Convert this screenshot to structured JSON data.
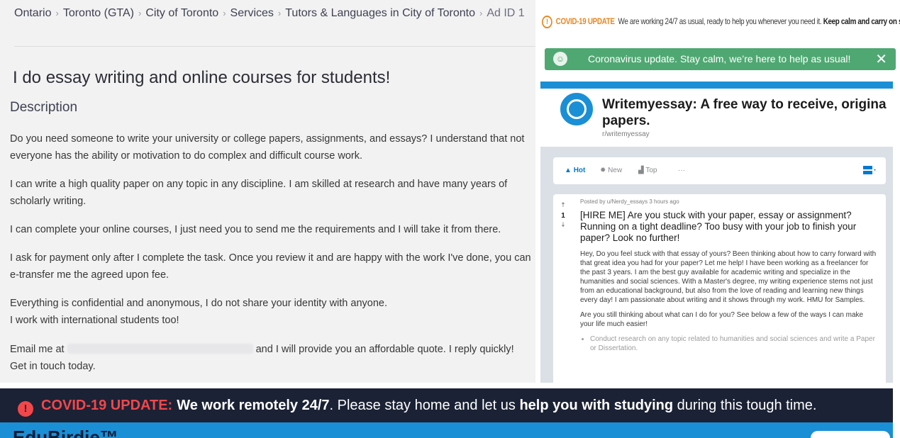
{
  "ad": {
    "breadcrumb": [
      "Ontario",
      "Toronto (GTA)",
      "City of Toronto",
      "Services",
      "Tutors & Languages in City of Toronto",
      "Ad ID 1"
    ],
    "title": "I do essay writing and online courses for students!",
    "description_heading": "Description",
    "paragraphs": [
      "Do you need someone to write your university or college papers, assignments, and essays? I understand that not everyone has the ability or motivation to do complex and difficult course work.",
      "I can write a high quality paper on any topic in any discipline. I am skilled at research and have many years of scholarly writing.",
      "I can complete your online courses, I just need you to send me the requirements and I will take it from there.",
      "I ask for payment only after I complete the task. Once you review it and are happy with the work I've done, you can e-transfer me the agreed upon fee.",
      "Everything is confidential and anonymous, I do not share your identity with anyone.",
      "I work with international students too!"
    ],
    "email_prefix": "Email me at ",
    "email_suffix": " and I will provide you an affordable quote. I reply quickly! Get in touch today."
  },
  "covid_top": {
    "label": "COVID-19 UPDATE",
    "text": "We are working 24/7 as usual, ready to help you whenever you need it.",
    "bold": "Keep calm and carry on studying."
  },
  "green_banner": {
    "text": "Coronavirus update. Stay calm, we’re here to help as usual!",
    "close": "✕"
  },
  "reddit": {
    "title_line1": "Writemyessay: A free way to receive, origina",
    "title_line2": "papers.",
    "subreddit": "r/writemyessay",
    "sort": {
      "hot": "Hot",
      "new": "New",
      "top": "Top",
      "more": "···"
    },
    "post": {
      "votes": "1",
      "meta": "Posted by u/Nerdy_essays 3 hours ago",
      "title": "[HIRE ME] Are you stuck with your paper, essay or assignment? Running on a tight deadline? Too busy with your job to finish your paper? Look no further!",
      "body1": "Hey, Do you feel stuck with that essay of yours? Been thinking about how to carry forward with that great idea you had for your paper? Let me help! I have been working as a freelancer for the past 3 years. I am the best guy available for academic writing and specialize in the humanities and social sciences. With a Master's degree, my writing experience stems not just from an educational background, but also from the love of reading and learning new things every day! I am passionate about writing and it shows through my work. HMU for Samples.",
      "body2": "Are you still thinking about what can I do for you? See below a few of the ways I can make your life much easier!",
      "bullet1": "Conduct research on any topic related to humanities and social sciences and write a Paper or Dissertation."
    }
  },
  "bottom_banner": {
    "label": "COVID-19 UPDATE:",
    "bold1": "We work remotely 24/7",
    "text1": ". Please stay home and let us ",
    "bold2": "help you with studying",
    "text2": " during this tough time.",
    "brand": "EduBirdie™"
  },
  "colors": {
    "green": "#4fa872",
    "reddit_blue": "#1a8fd6",
    "covid_orange": "#e9861f",
    "covid_red": "#f2474a",
    "banner_dark": "#1b2235"
  }
}
